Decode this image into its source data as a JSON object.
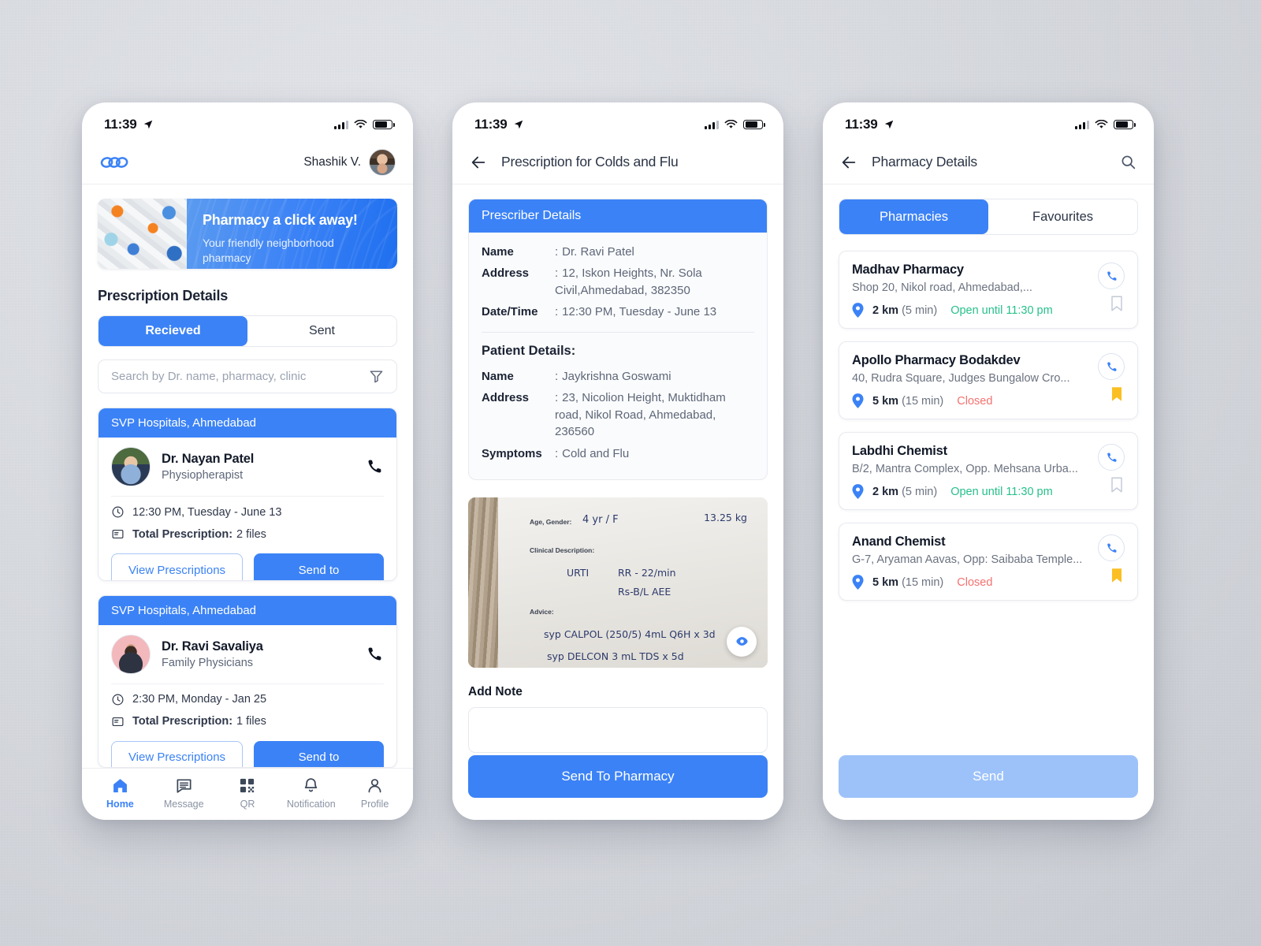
{
  "status_bar": {
    "time": "11:39",
    "location_icon": "location-arrow-icon",
    "signal_icon": "cellular-signal-icon",
    "wifi_icon": "wifi-icon",
    "battery_icon": "battery-icon"
  },
  "colors": {
    "accent": "#3b82f6",
    "accent_disabled": "#9dc2fa",
    "open": "#27c08a",
    "closed": "#f4716f",
    "bookmark_active": "#fbbf24"
  },
  "home": {
    "logo_name": "app-logo",
    "user_name": "Shashik V.",
    "banner": {
      "title": "Pharmacy a click away!",
      "subtitle": "Your friendly neighborhood pharmacy"
    },
    "section_title": "Prescription Details",
    "tabs": [
      {
        "label": "Recieved",
        "active": true
      },
      {
        "label": "Sent",
        "active": false
      }
    ],
    "search": {
      "placeholder": "Search by Dr. name, pharmacy, clinic",
      "filter_icon": "filter-icon"
    },
    "cards": [
      {
        "hospital": "SVP Hospitals, Ahmedabad",
        "doctor": "Dr. Nayan Patel",
        "speciality": "Physiopherapist",
        "datetime": "12:30 PM, Tuesday - June 13",
        "total_label": "Total Prescription:",
        "total_value": "2 files",
        "view_label": "View Prescriptions",
        "send_label": "Send to"
      },
      {
        "hospital": "SVP Hospitals, Ahmedabad",
        "doctor": "Dr. Ravi Savaliya",
        "speciality": "Family Physicians",
        "datetime": "2:30 PM, Monday - Jan 25",
        "total_label": "Total Prescription:",
        "total_value": "1 files",
        "view_label": "View Prescriptions",
        "send_label": "Send to"
      }
    ],
    "tabbar": [
      {
        "label": "Home",
        "icon": "home-icon",
        "active": true
      },
      {
        "label": "Message",
        "icon": "message-icon",
        "active": false
      },
      {
        "label": "QR",
        "icon": "qr-code-icon",
        "active": false
      },
      {
        "label": "Notification",
        "icon": "bell-icon",
        "active": false
      },
      {
        "label": "Profile",
        "icon": "person-icon",
        "active": false
      }
    ]
  },
  "prescription": {
    "title": "Prescription for Colds and Flu",
    "back_icon": "back-arrow-icon",
    "prescriber": {
      "header": "Prescriber Details",
      "rows": [
        {
          "key": "Name",
          "value": "Dr. Ravi Patel"
        },
        {
          "key": "Address",
          "value": "12, Iskon Heights, Nr. Sola Civil,Ahmedabad, 382350"
        },
        {
          "key": "Date/Time",
          "value": "12:30 PM, Tuesday - June 13"
        }
      ]
    },
    "patient": {
      "header": "Patient Details:",
      "rows": [
        {
          "key": "Name",
          "value": "Jaykrishna Goswami"
        },
        {
          "key": "Address",
          "value": "23, Nicolion Height, Muktidham road, Nikol Road, Ahmedabad, 236560"
        },
        {
          "key": "Symptoms",
          "value": "Cold and Flu"
        }
      ]
    },
    "scan": {
      "label_age": "Age, Gender:",
      "value_age": "4 yr / F",
      "weight": "13.25 kg",
      "label_clinical": "Clinical Description:",
      "clinical_1": "URTI",
      "clinical_2": "RR - 22/min",
      "clinical_3": "Rs-B/L AEE",
      "label_advice": "Advice:",
      "advice_1": "syp CALPOL (250/5)  4mL Q6H x 3d",
      "advice_2": "syp  DELCON   3 mL TDS x 5d",
      "view_icon": "eye-icon"
    },
    "note_label": "Add Note",
    "note_value": "",
    "cta_label": "Send To Pharmacy"
  },
  "pharmacy": {
    "title": "Pharmacy Details",
    "back_icon": "back-arrow-icon",
    "search_icon": "search-icon",
    "tabs": [
      {
        "label": "Pharmacies",
        "active": true
      },
      {
        "label": "Favourites",
        "active": false
      }
    ],
    "items": [
      {
        "name": "Madhav Pharmacy",
        "address": "Shop 20, Nikol road, Ahmedabad,...",
        "distance": "2 km",
        "eta": "(5 min)",
        "status": "Open until 11:30 pm",
        "status_type": "open",
        "bookmarked": false
      },
      {
        "name": "Apollo Pharmacy Bodakdev",
        "address": "40, Rudra Square, Judges Bungalow Cro...",
        "distance": "5 km",
        "eta": "(15 min)",
        "status": "Closed",
        "status_type": "closed",
        "bookmarked": true
      },
      {
        "name": "Labdhi Chemist",
        "address": "B/2, Mantra Complex, Opp. Mehsana Urba...",
        "distance": "2 km",
        "eta": "(5 min)",
        "status": "Open until 11:30 pm",
        "status_type": "open",
        "bookmarked": false
      },
      {
        "name": "Anand Chemist",
        "address": "G-7, Aryaman Aavas, Opp: Saibaba Temple...",
        "distance": "5 km",
        "eta": "(15 min)",
        "status": "Closed",
        "status_type": "closed",
        "bookmarked": true
      }
    ],
    "cta_label": "Send",
    "cta_disabled": true
  }
}
